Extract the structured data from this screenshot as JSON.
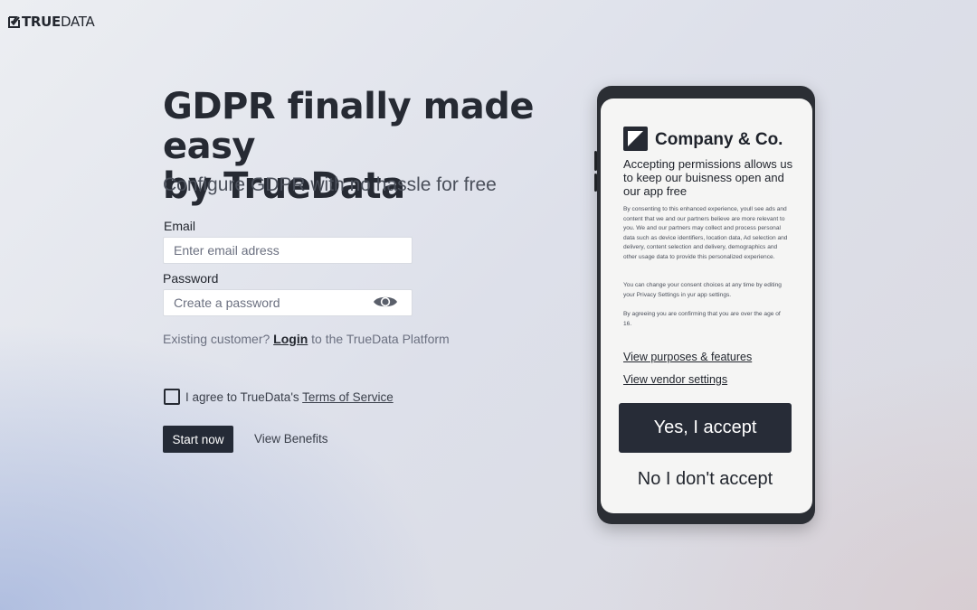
{
  "logo": {
    "brand_bold": "TRUE",
    "brand_light": "DATA",
    "icon": "checkbox-check-icon"
  },
  "hero": {
    "headline_line1": "GDPR finally made easy",
    "headline_line2": "by TrueData",
    "subhead": "Configure GDPR with no hassle for free"
  },
  "form": {
    "email_label": "Email",
    "email_placeholder": "Enter email adress",
    "email_value": "",
    "password_label": "Password",
    "password_placeholder": "Create a password",
    "password_value": "",
    "password_toggle_icon": "eye-icon",
    "existing_prefix": "Existing customer?",
    "login_link": "Login",
    "existing_suffix": "to the TrueData Platform",
    "agree_prefix": "I agree to TrueData's",
    "terms_link": "Terms of Service",
    "agree_checked": false,
    "start_button": "Start now",
    "benefits_link": "View Benefits"
  },
  "phone": {
    "company_icon": "company-logo-icon",
    "company_name": "Company & Co.",
    "lead": "Accepting permissions allows us to keep our buisness open and our app free",
    "paragraph1": "By consenting to this enhanced experience, youll see ads and content that we and our partners believe are more relevant to you. We and our partners may collect and process personal data such as device identifiers, location data, Ad selection and delivery, content selection and delivery, demographics and other usage data to provide this personalized experience.",
    "paragraph2": "You can change your consent choices at any time by editing your Privacy Settings in yur app settings.",
    "paragraph3": "By agreeing you are confirming that you are over the age of 16.",
    "link_purposes": "View purposes & features",
    "link_vendors": "View vendor settings",
    "accept_button": "Yes, I accept",
    "decline_button": "No I don't accept"
  },
  "colors": {
    "primary_dark": "#242a36",
    "text_dark": "#23272f",
    "muted": "#6b7080",
    "phone_frame": "#2b2e34",
    "phone_screen": "#f5f5f4"
  }
}
